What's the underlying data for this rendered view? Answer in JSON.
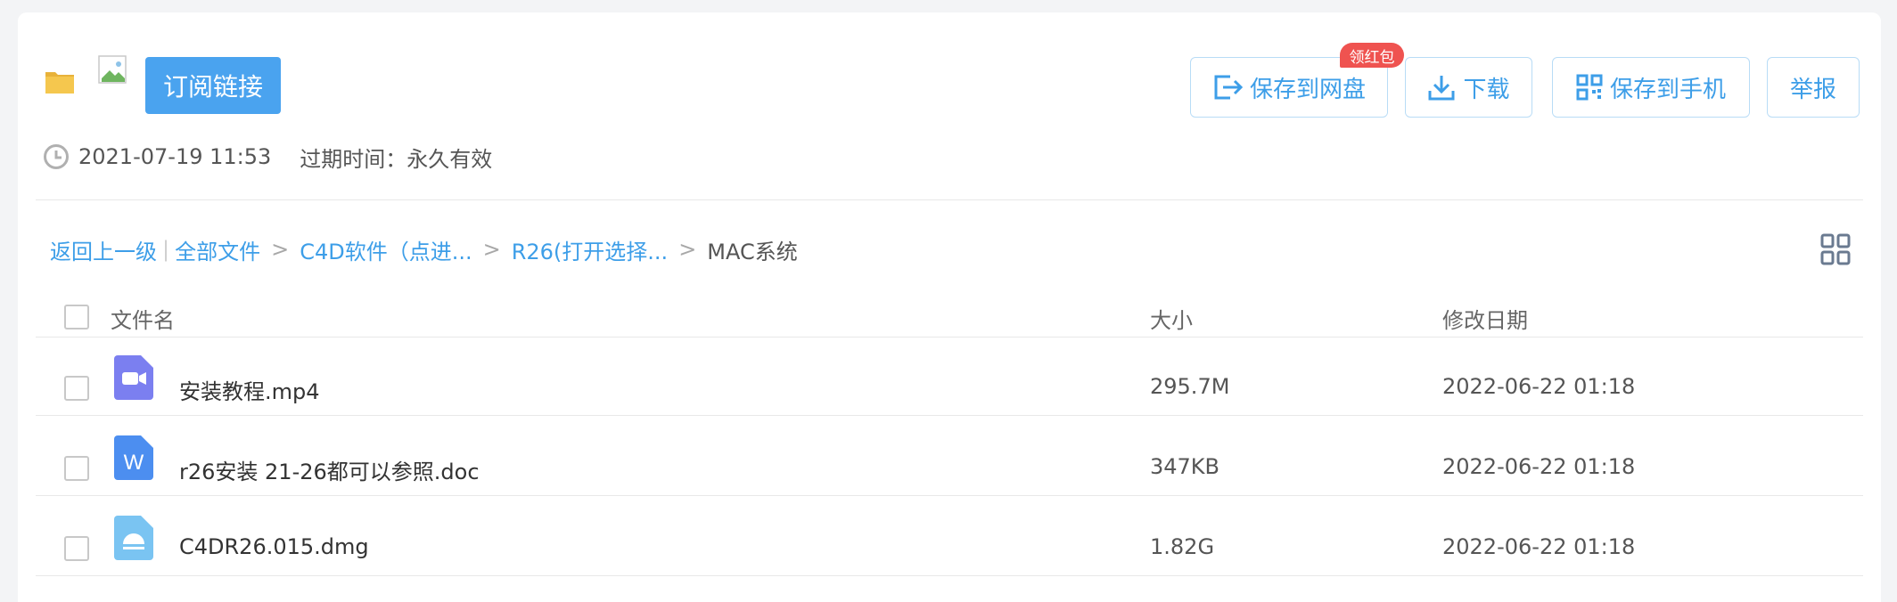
{
  "header": {
    "subscribe_label": "订阅链接",
    "actions": {
      "save_to_disk": "保存到网盘",
      "badge": "领红包",
      "download": "下载",
      "save_to_phone": "保存到手机",
      "report": "举报"
    },
    "created_time": "2021-07-19 11:53",
    "expire_label": "过期时间：",
    "expire_value": "永久有效"
  },
  "breadcrumb": {
    "back": "返回上一级",
    "all_files": "全部文件",
    "level1": "C4D软件（点进...",
    "level2": "R26(打开选择...",
    "current": "MAC系统",
    "separator": ">",
    "bar": "|"
  },
  "table": {
    "headers": {
      "name": "文件名",
      "size": "大小",
      "modified": "修改日期"
    },
    "rows": [
      {
        "name": "安装教程.mp4",
        "size": "295.7M",
        "modified": "2022-06-22 01:18",
        "icon": "video-file-icon"
      },
      {
        "name": "r26安装 21-26都可以参照.doc",
        "size": "347KB",
        "modified": "2022-06-22 01:18",
        "icon": "word-file-icon"
      },
      {
        "name": "C4DR26.015.dmg",
        "size": "1.82G",
        "modified": "2022-06-22 01:18",
        "icon": "dmg-file-icon"
      }
    ]
  },
  "colors": {
    "accent": "#3d9ee8",
    "button_fill": "#4aa3ef",
    "badge": "#ef5350",
    "video_icon": "#7b7ff0",
    "word_icon": "#4c8ef0",
    "dmg_icon": "#7ac4f2"
  }
}
